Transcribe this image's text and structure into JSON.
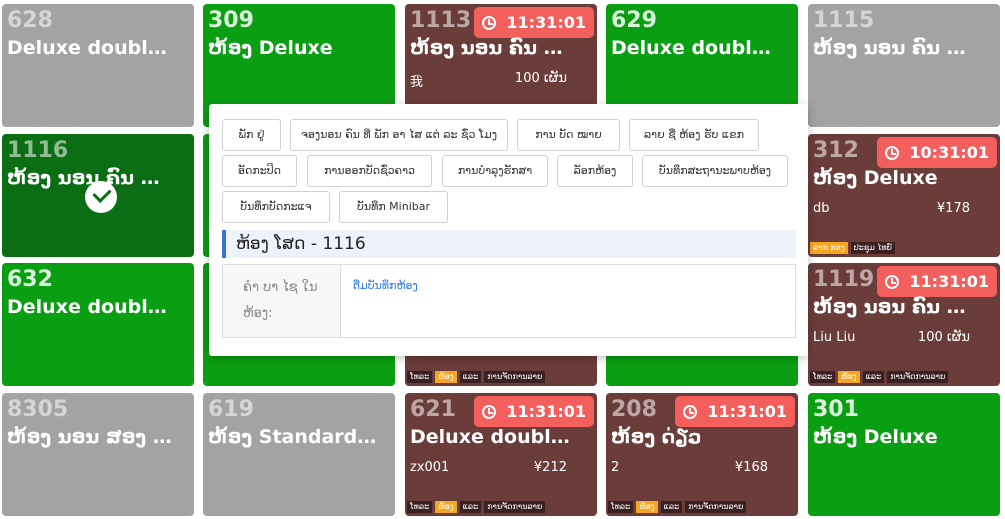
{
  "rooms": [
    {
      "number": "628",
      "type": "Deluxe doubl…",
      "color": "#a3a3a3"
    },
    {
      "number": "309",
      "type": "ຫ້ອງ Deluxe",
      "color": "#0a9e12"
    },
    {
      "number": "1113",
      "type": "ຫ້ອງ ນອນ ຄົນ …",
      "timer": "11:31:01",
      "guest": "我",
      "price": "100 ເຜັນ",
      "color": "#6b3d3a"
    },
    {
      "number": "629",
      "type": "Deluxe doubl…",
      "color": "#0a9e12"
    },
    {
      "number": "1115",
      "type": "ຫ້ອງ ນອນ ຄົນ …",
      "color": "#a3a3a3"
    },
    {
      "number": "1116",
      "type": "ຫ້ອງ ນອນ ຄົນ …",
      "color": "#0b6e14",
      "selected": true
    },
    {
      "number": "312",
      "type": "ຫ້ອງ Deluxe",
      "timer": "10:31:01",
      "guest": "db",
      "price": "¥178",
      "tags": [
        "ລາກ ກອງ",
        "ປະຊຸມ ໄທຍ໌"
      ],
      "color": "#6b3d3a"
    },
    {
      "number": "632",
      "type": "Deluxe doubl…",
      "color": "#0a9e12"
    },
    {
      "number": "1119",
      "type": "ຫ້ອງ ນອນ ຄົນ …",
      "timer": "11:31:01",
      "guest": "Liu Liu",
      "price": "100 ເຜັນ",
      "tags": [
        "ໂທລະ",
        "ຫ້ອງ",
        "ແລະ",
        "ການຈັດການລາຍ"
      ],
      "color": "#6b3d3a"
    },
    {
      "number": "8305",
      "type": "ຫ້ອງ ນອນ ສອງ …",
      "color": "#a3a3a3"
    },
    {
      "number": "619",
      "type": "ຫ້ອງ Standard…",
      "color": "#a3a3a3"
    },
    {
      "number": "621",
      "type": "Deluxe doubl…",
      "timer": "11:31:01",
      "guest": "zx001",
      "price": "¥212",
      "tags": [
        "ໂທລະ",
        "ຫ້ອງ",
        "ແລະ",
        "ການຈັດການລາຍ"
      ],
      "color": "#6b3d3a"
    },
    {
      "number": "208",
      "type": "ຫ້ອງ ດ່ຽວ",
      "timer": "11:31:01",
      "guest": "2",
      "price": "¥168",
      "tags": [
        "ໂທລະ",
        "ຫ້ອງ",
        "ແລະ",
        "ການຈັດການລາຍ"
      ],
      "color": "#6b3d3a"
    },
    {
      "number": "301",
      "type": "ຫ້ອງ Deluxe",
      "color": "#0a9e12"
    }
  ],
  "hidden_tags": {
    "row3_col2": [
      "ໂທລະ",
      "ຫ້ອງ",
      "ແລະ",
      "ການຈັດການລາຍ"
    ]
  },
  "popup": {
    "buttons": [
      "ພັກ ຢູ່",
      "ຈອງນອນ ຄົນ ທີ່ ພັກ ອາ ໄສ ແຕ່ ລະ ຊົ່ວ ໂມງ",
      "ການ ບັດ ໝາຍ",
      "ລາຍ ຊື່ ຫ້ອງ ຮັບ ແຂກ",
      "ອັດກະປິດ",
      "ການອອກບັດຊົ່ວຄາວ",
      "ການບໍາລຸງຮັກສາ",
      "ລັອກຫ້ອງ",
      "ບັນທຶກສະຖານະພາບຫ້ອງ",
      "ບັນທຶກບັດກະແຈ",
      "ບັນທຶກ Minibar"
    ],
    "title": "ຫ້ອງ ໂສດ - 1116",
    "note_label": "ຄໍາ ບາ ໄຊ ໃນ ຫ້ອງ:",
    "add_note_link": "ຕື່ມບັນທຶກຫ້ອງ"
  }
}
